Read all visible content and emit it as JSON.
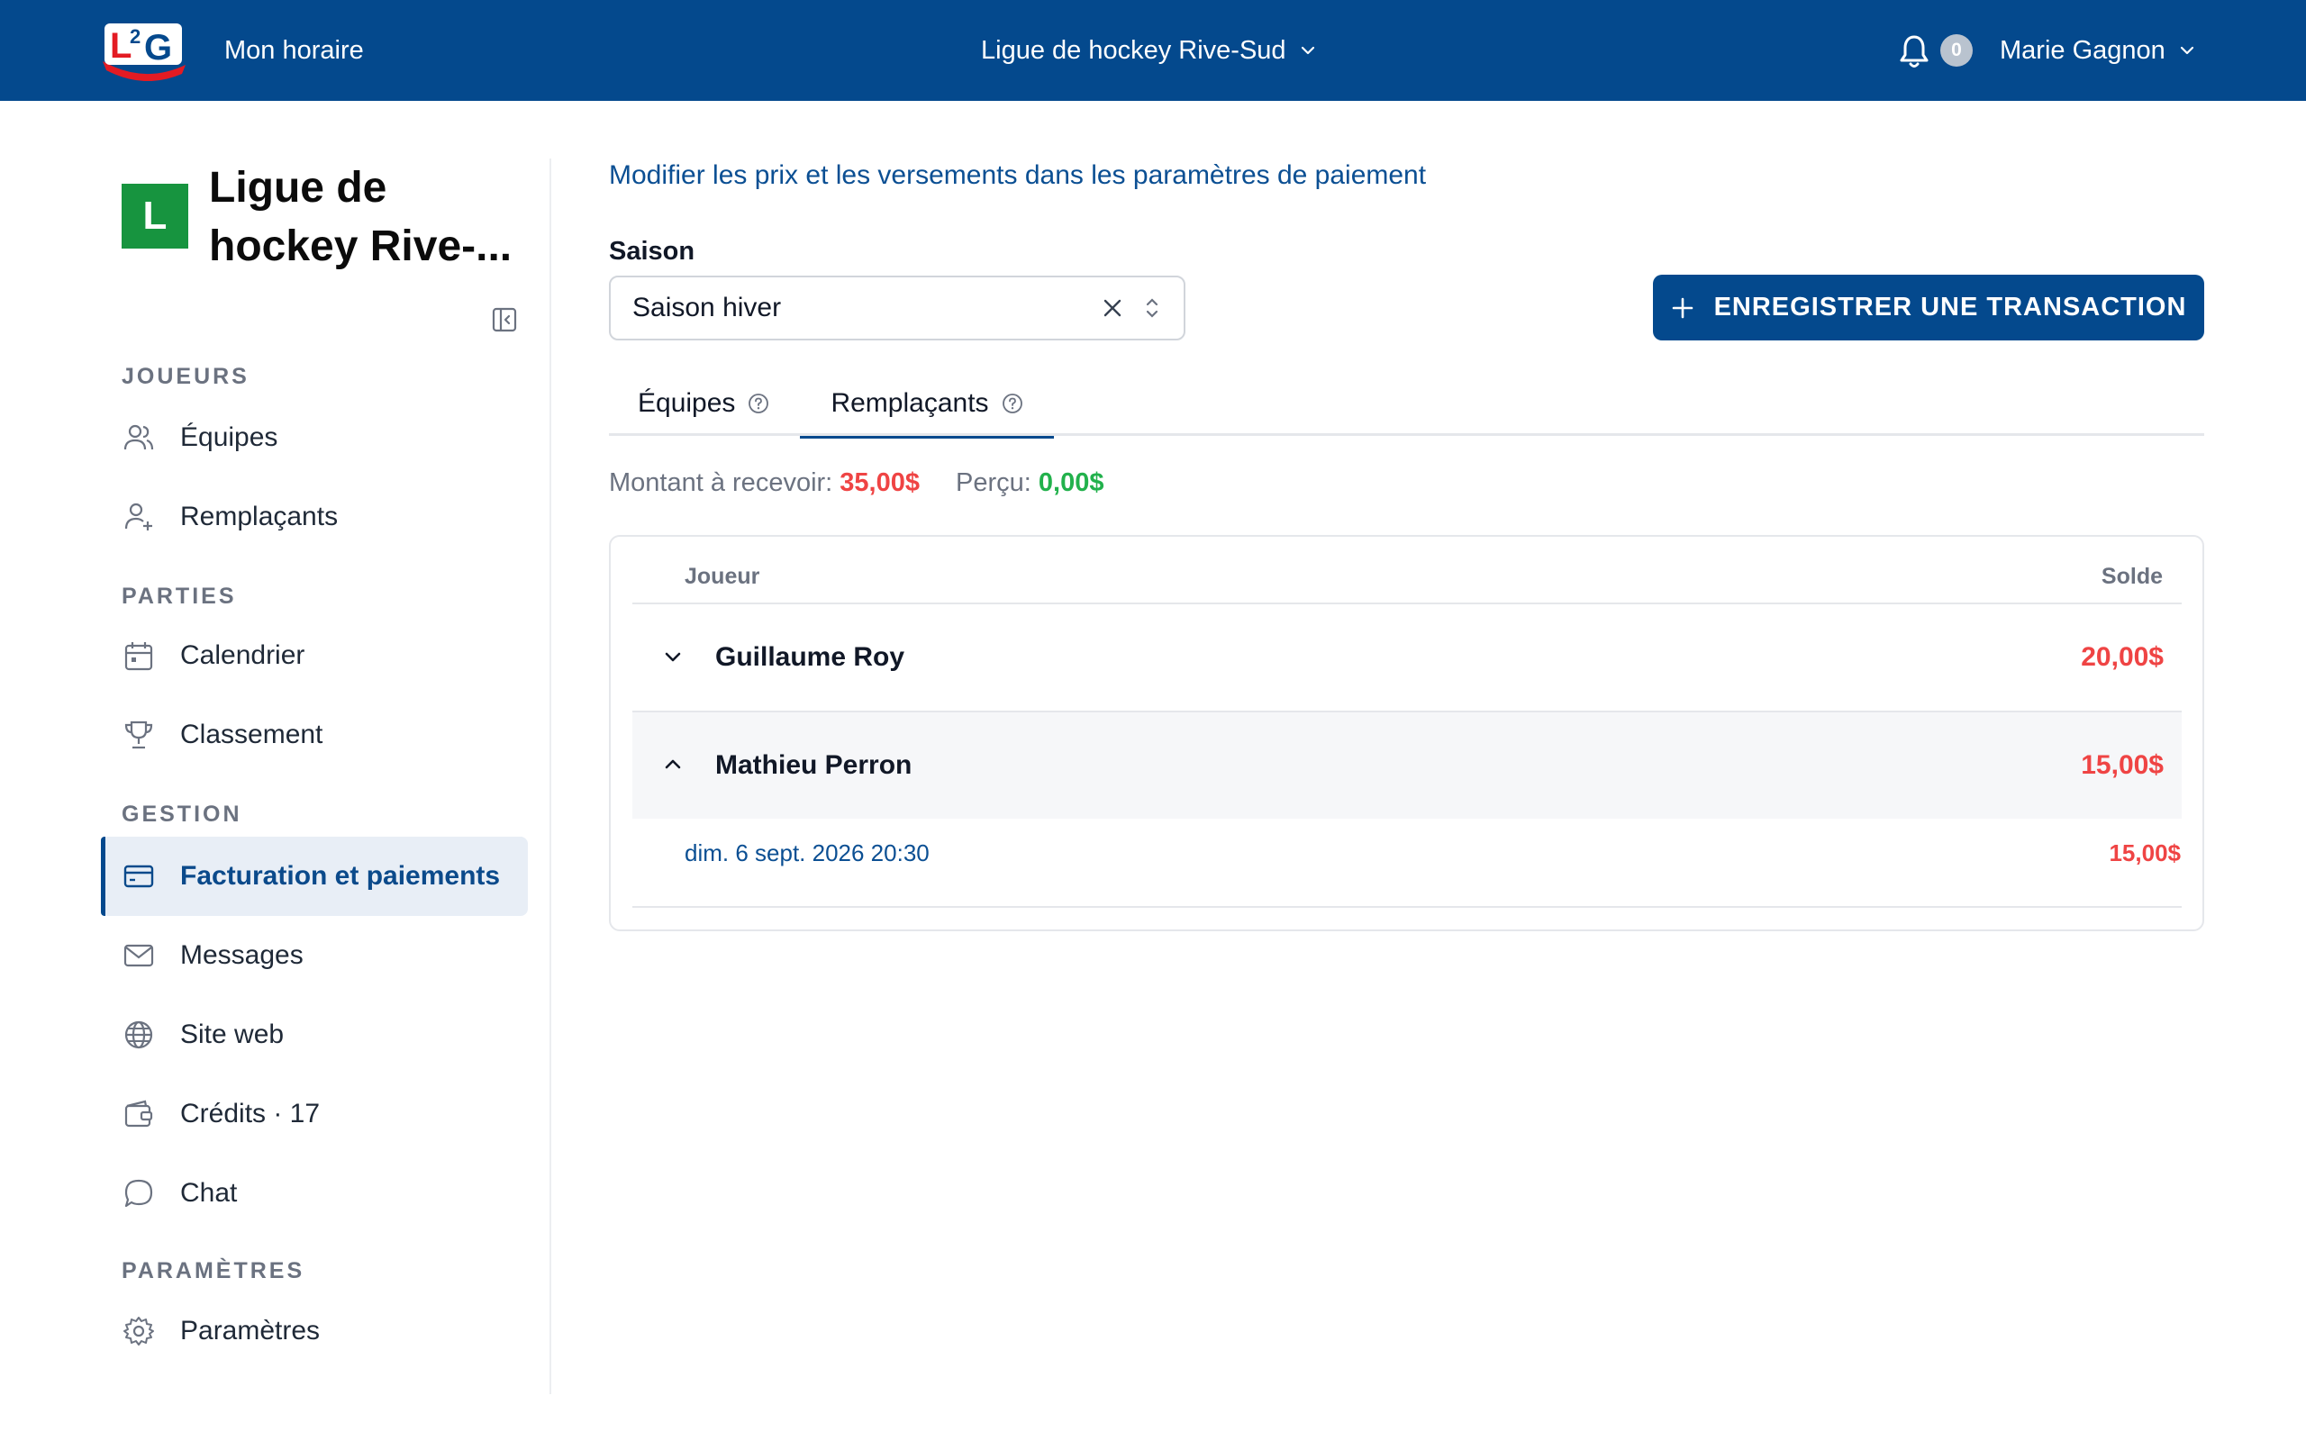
{
  "colors": {
    "primary": "#04498d",
    "danger": "#ef4444",
    "success": "#22b14c",
    "org_avatar": "#17943f"
  },
  "topbar": {
    "logo_text": "L2G",
    "my_schedule": "Mon horaire",
    "league_name": "Ligue de hockey Rive-Sud",
    "notification_count": "0",
    "user_name": "Marie Gagnon"
  },
  "sidebar": {
    "org_initial": "L",
    "org_name": "Ligue de hockey Rive-...",
    "sections": {
      "players": "JOUEURS",
      "games": "PARTIES",
      "management": "GESTION",
      "settings": "PARAMÈTRES"
    },
    "items": {
      "teams": "Équipes",
      "substitutes": "Remplaçants",
      "calendar": "Calendrier",
      "standings": "Classement",
      "billing": "Facturation et paiements",
      "messages": "Messages",
      "website": "Site web",
      "credits": "Crédits · 17",
      "chat": "Chat",
      "settings": "Paramètres"
    },
    "active_item": "billing"
  },
  "main": {
    "payment_settings_link": "Modifier les prix et les versements dans les paramètres de paiement",
    "season_label": "Saison",
    "season_value": "Saison hiver",
    "record_button": "ENREGISTRER UNE TRANSACTION",
    "tabs": {
      "teams": "Équipes",
      "substitutes": "Remplaçants",
      "active": "substitutes"
    },
    "summary": {
      "due_label": "Montant à recevoir:",
      "due_value": "35,00$",
      "paid_label": "Perçu:",
      "paid_value": "0,00$"
    },
    "table": {
      "col_player": "Joueur",
      "col_balance": "Solde",
      "rows": [
        {
          "name": "Guillaume Roy",
          "balance": "20,00$",
          "expanded": false
        },
        {
          "name": "Mathieu Perron",
          "balance": "15,00$",
          "expanded": true
        }
      ],
      "detail": {
        "date": "dim. 6 sept. 2026 20:30",
        "amount": "15,00$"
      }
    }
  }
}
